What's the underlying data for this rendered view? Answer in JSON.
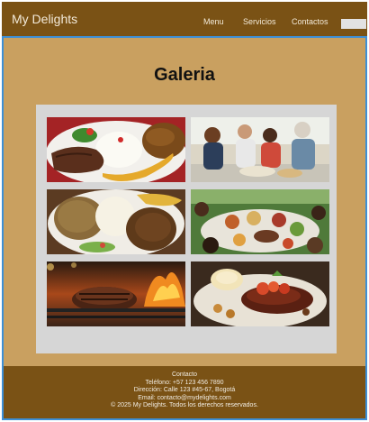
{
  "navbar": {
    "brand": "My Delights",
    "links": [
      "Menu",
      "Servicios",
      "Contactos"
    ]
  },
  "main": {
    "title": "Galeria",
    "photos": [
      "steak-rice-plantain-photo",
      "people-cooking-photo",
      "rice-beans-plate-photo",
      "feast-table-photo",
      "grilled-steak-photo",
      "steak-sauce-plate-photo"
    ]
  },
  "footer": {
    "heading": "Contacto",
    "phone": "Teléfono: +57 123 456 7890",
    "address": "Dirección: Calle 123 #45-67, Bogotá",
    "email": "Email: contacto@mydelights.com",
    "copyright": "© 2025 My Delights. Todos los derechos reservados."
  },
  "colors": {
    "header_brown": "#7a5215",
    "content_tan": "#c9a060",
    "panel_gray": "#d6d6d6",
    "selection_blue": "#3d8fd6"
  }
}
